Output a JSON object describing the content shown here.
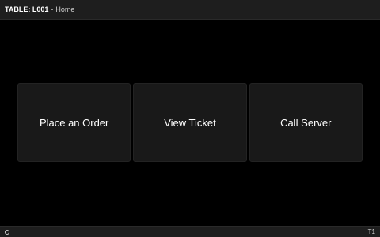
{
  "header": {
    "table_id": "TABLE: L001",
    "separator": "-",
    "page_title": "Home"
  },
  "actions": [
    {
      "label": "Place an Order"
    },
    {
      "label": "View Ticket"
    },
    {
      "label": "Call Server"
    }
  ],
  "footer": {
    "settings_icon": "gear-icon",
    "terminal_label": "T1"
  },
  "colors": {
    "background": "#000000",
    "bar": "#1e1e1e",
    "tile": "#191919",
    "text": "#ffffff"
  }
}
